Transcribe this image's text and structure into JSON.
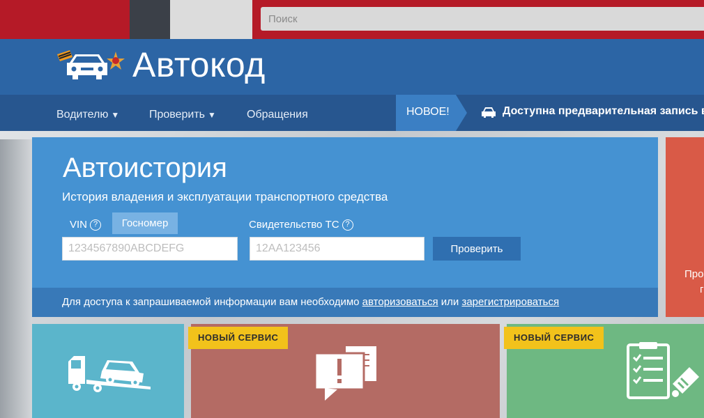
{
  "search": {
    "placeholder": "Поиск"
  },
  "header": {
    "logo_text": "Автокод"
  },
  "nav": {
    "items": [
      {
        "label": "Водителю",
        "caret": "▼"
      },
      {
        "label": "Проверить",
        "caret": "▼"
      },
      {
        "label": "Обращения",
        "caret": ""
      }
    ]
  },
  "news": {
    "badge": "НОВОЕ!",
    "text": "Доступна предварительная запись в П"
  },
  "card": {
    "title": "Автоистория",
    "subtitle": "История владения и эксплуатации транспортного средства",
    "vin_label": "VIN",
    "help_glyph": "?",
    "gos_tab": "Госномер",
    "sts_label": "Свидетельство ТС",
    "vin_placeholder": "1234567890ABCDEFG",
    "sts_placeholder": "12АА123456",
    "check_button": "Проверить",
    "footer_prefix": "Для доступа к запрашиваемой информации вам необходимо",
    "footer_link_login": "авторизоваться",
    "footer_or": "или",
    "footer_link_register": "зарегистрироваться"
  },
  "side_card": {
    "line1": "Про",
    "line2": "г"
  },
  "tiles": {
    "badge_new": "НОВЫЙ СЕРВИС"
  },
  "colors": {
    "top_red": "#b51a27",
    "header_blue": "#2c65a5",
    "nav_blue": "#27568f",
    "card_blue": "#4592d2",
    "badge_yellow": "#f2c21b"
  }
}
